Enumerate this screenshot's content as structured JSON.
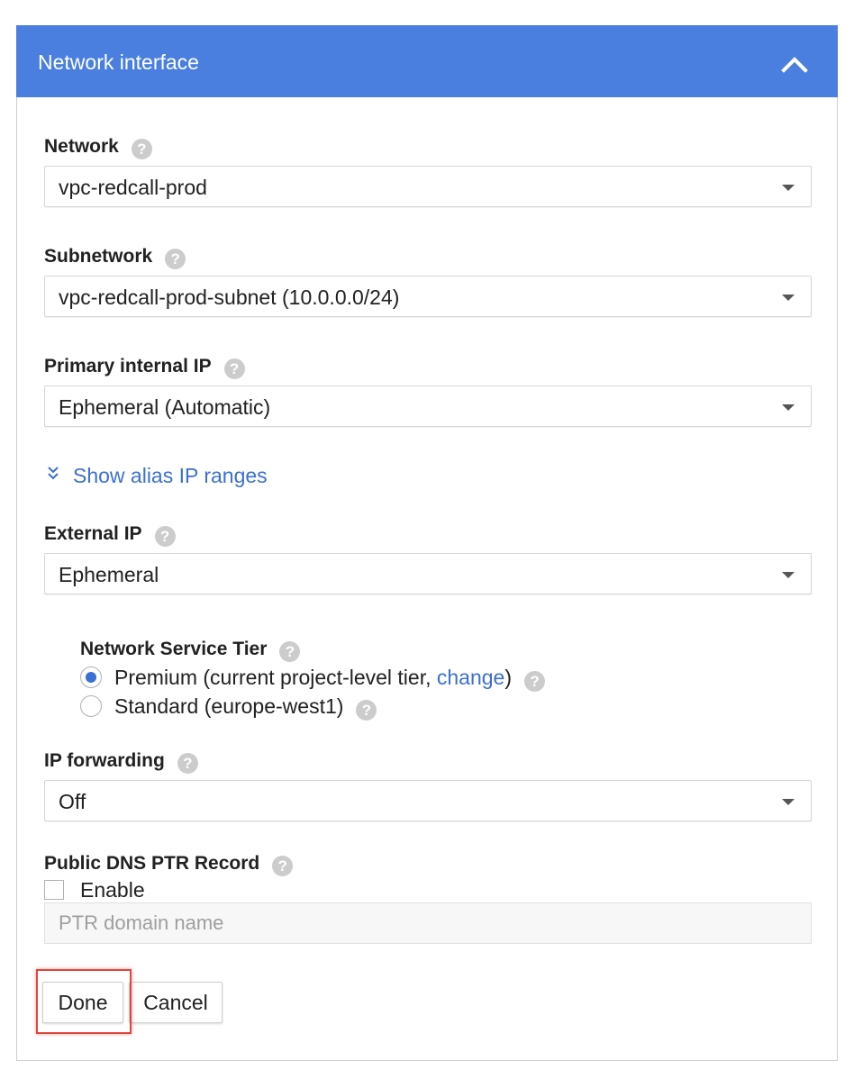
{
  "panel": {
    "title": "Network interface",
    "header_color": "#4a7fe0",
    "collapse_icon": "chevron-up-icon"
  },
  "network": {
    "label": "Network",
    "value": "vpc-redcall-prod"
  },
  "subnetwork": {
    "label": "Subnetwork",
    "value": "vpc-redcall-prod-subnet (10.0.0.0/24)"
  },
  "primary_ip": {
    "label": "Primary internal IP",
    "value": "Ephemeral (Automatic)"
  },
  "alias": {
    "link_text": "Show alias IP ranges",
    "icon": "double-chevron-down-icon"
  },
  "external_ip": {
    "label": "External IP",
    "value": "Ephemeral"
  },
  "tier": {
    "label": "Network Service Tier",
    "premium_prefix": "Premium (current project-level tier, ",
    "premium_link": "change",
    "premium_suffix": ")",
    "standard_label": "Standard (europe-west1)",
    "selected": "premium"
  },
  "ip_forwarding": {
    "label": "IP forwarding",
    "value": "Off"
  },
  "ptr": {
    "label": "Public DNS PTR Record",
    "enable_label": "Enable",
    "enabled": false,
    "placeholder": "PTR domain name"
  },
  "buttons": {
    "done": "Done",
    "cancel": "Cancel"
  },
  "help_glyph": "?",
  "accent_color": "#3b6fd4",
  "highlight_color": "#e0463a"
}
